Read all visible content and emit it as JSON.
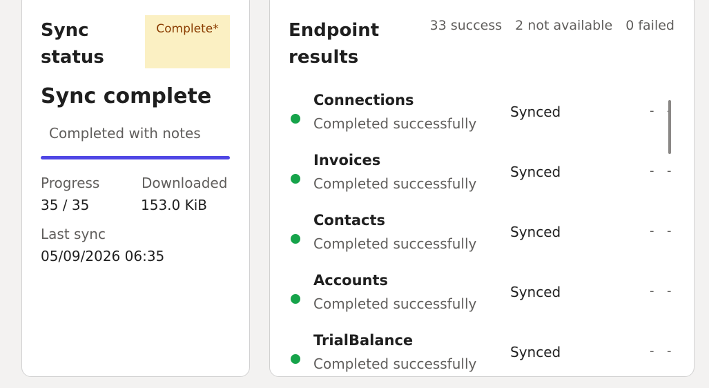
{
  "status_card": {
    "title": "Sync status",
    "badge": "Complete*",
    "headline": "Sync complete",
    "tab_label": "Completed with notes",
    "progress_label": "Progress",
    "progress_value": "35 / 35",
    "downloaded_label": "Downloaded",
    "downloaded_value": "153.0 KiB",
    "last_sync_label": "Last sync",
    "last_sync_value": "05/09/2026 06:35"
  },
  "endpoint_card": {
    "title": "Endpoint results",
    "summary": {
      "success": "33 success",
      "not_available": "2 not available",
      "failed": "0 failed"
    },
    "rows": [
      {
        "name": "Connections",
        "desc": "Completed successfully",
        "state": "Synced",
        "c1": "-",
        "c2": "-"
      },
      {
        "name": "Invoices",
        "desc": "Completed successfully",
        "state": "Synced",
        "c1": "-",
        "c2": "-"
      },
      {
        "name": "Contacts",
        "desc": "Completed successfully",
        "state": "Synced",
        "c1": "-",
        "c2": "-"
      },
      {
        "name": "Accounts",
        "desc": "Completed successfully",
        "state": "Synced",
        "c1": "-",
        "c2": "-"
      },
      {
        "name": "TrialBalance",
        "desc": "Completed successfully",
        "state": "Synced",
        "c1": "-",
        "c2": "-"
      }
    ]
  },
  "colors": {
    "accent": "#4f46e5",
    "success": "#16a34a",
    "badge_bg": "#fbf0c3",
    "badge_text": "#8a3c00"
  },
  "icons": {
    "status_dot": "green-dot-icon"
  }
}
